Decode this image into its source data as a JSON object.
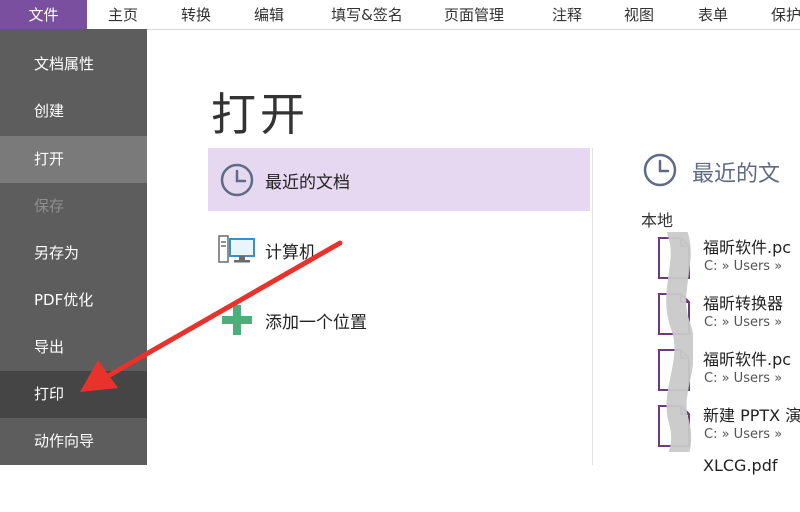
{
  "ribbon": {
    "tabs": [
      "文件",
      "主页",
      "转换",
      "编辑",
      "填写&签名",
      "页面管理",
      "注释",
      "视图",
      "表单",
      "保护"
    ]
  },
  "sidebar": {
    "items": [
      "文档属性",
      "创建",
      "打开",
      "保存",
      "另存为",
      "PDF优化",
      "导出",
      "打印",
      "动作向导"
    ]
  },
  "main": {
    "title": "打开",
    "places": [
      "最近的文档",
      "计算机",
      "添加一个位置"
    ],
    "recent_heading": "最近的文",
    "group_label": "本地",
    "recent_files": [
      {
        "name": "福昕软件.pc",
        "path": "C: » Users »"
      },
      {
        "name": "福昕转换器",
        "path": "C: » Users »"
      },
      {
        "name": "福昕软件.pc",
        "path": "C: » Users »"
      },
      {
        "name": "新建 PPTX 演",
        "path": "C: » Users »"
      },
      {
        "name": "XLCG.pdf",
        "path": ""
      }
    ]
  },
  "colors": {
    "accent": "#7b4fa0",
    "sidebar": "#5d5d5d",
    "selected_place": "#e7d8f1",
    "arrow": "#e8322b"
  }
}
